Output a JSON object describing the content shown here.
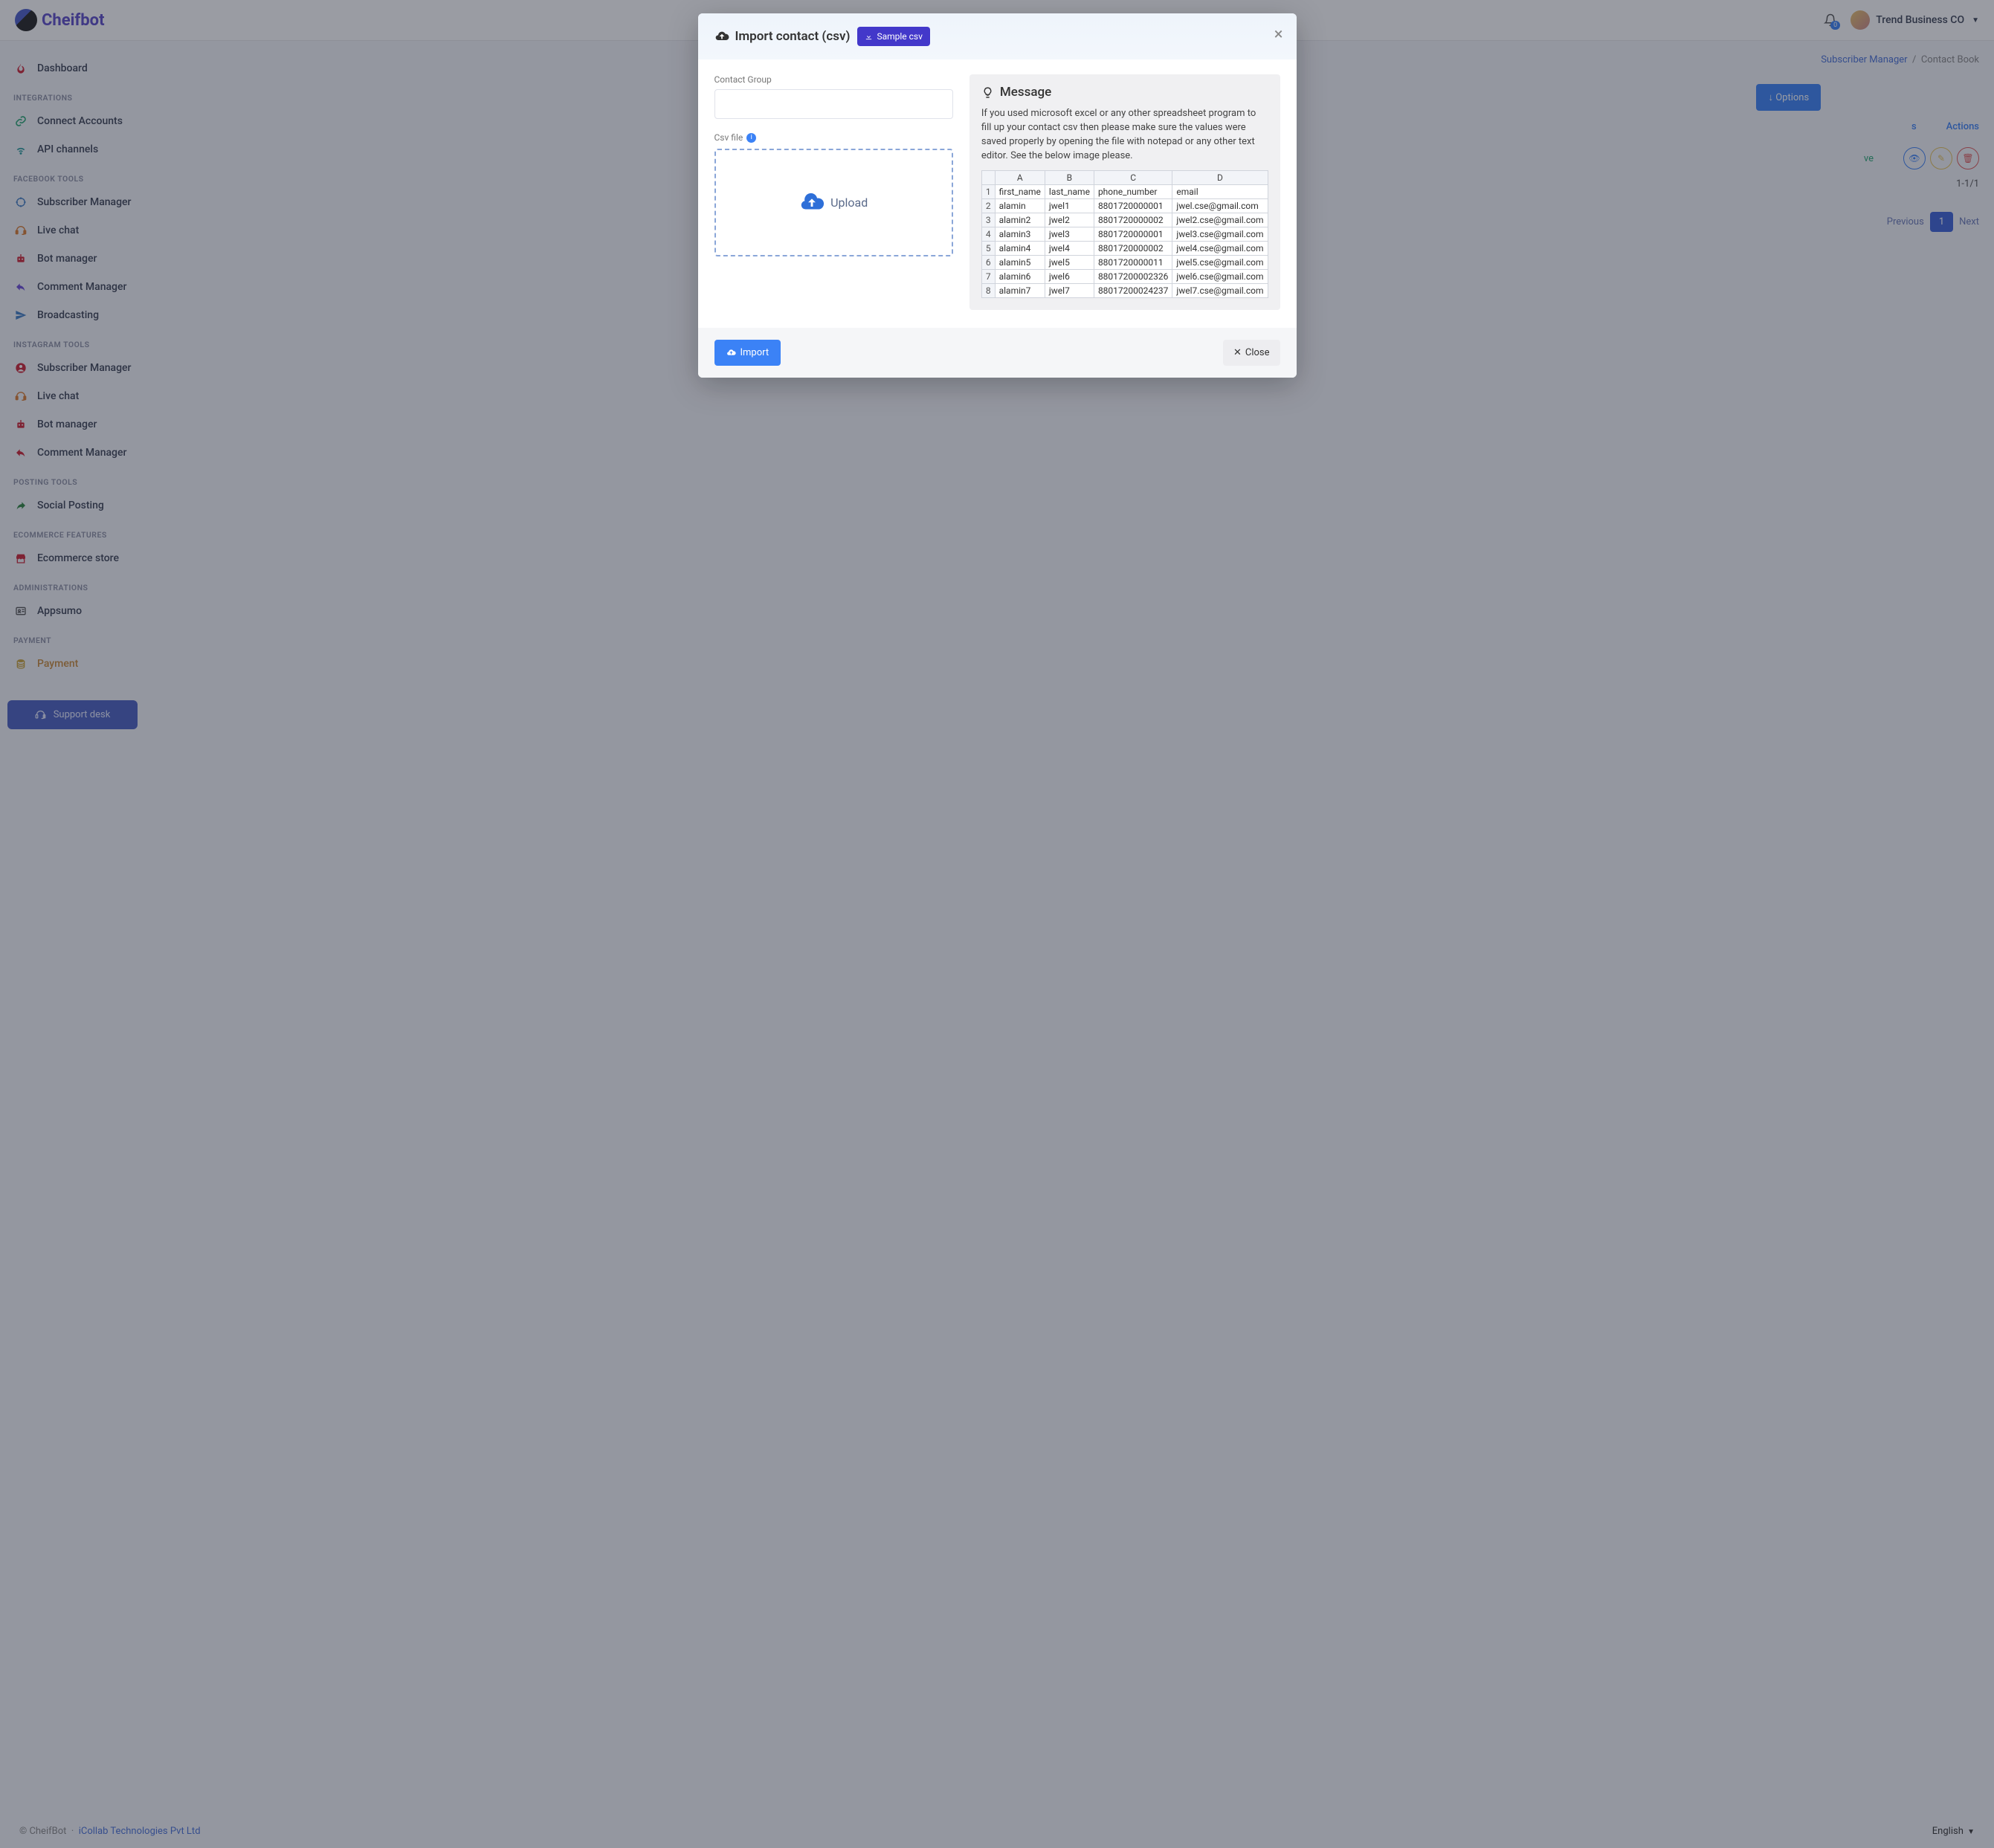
{
  "brand": "Cheifbot",
  "topbar": {
    "user_label": "Trend Business CO",
    "bell_count": "0"
  },
  "sidebar": {
    "dashboard": "Dashboard",
    "groups": [
      {
        "title": "INTEGRATIONS",
        "items": [
          {
            "label": "Connect Accounts",
            "color": "green",
            "icon": "connect-icon"
          },
          {
            "label": "API channels",
            "color": "teal",
            "icon": "wifi-icon"
          }
        ]
      },
      {
        "title": "FACEBOOK TOOLS",
        "items": [
          {
            "label": "Subscriber Manager",
            "color": "blue",
            "icon": "crosshair-icon"
          },
          {
            "label": "Live chat",
            "color": "orange",
            "icon": "headset-icon"
          },
          {
            "label": "Bot manager",
            "color": "red",
            "icon": "robot-icon"
          },
          {
            "label": "Comment Manager",
            "color": "purple",
            "icon": "reply-icon"
          },
          {
            "label": "Broadcasting",
            "color": "blue",
            "icon": "plane-icon"
          }
        ]
      },
      {
        "title": "INSTAGRAM TOOLS",
        "items": [
          {
            "label": "Subscriber Manager",
            "color": "red",
            "icon": "user-circle-icon"
          },
          {
            "label": "Live chat",
            "color": "orange",
            "icon": "headset-icon"
          },
          {
            "label": "Bot manager",
            "color": "red",
            "icon": "robot-icon"
          },
          {
            "label": "Comment Manager",
            "color": "red",
            "icon": "reply-icon"
          }
        ]
      },
      {
        "title": "POSTING TOOLS",
        "items": [
          {
            "label": "Social Posting",
            "color": "dkgreen",
            "icon": "share-icon"
          }
        ]
      },
      {
        "title": "ECOMMERCE FEATURES",
        "items": [
          {
            "label": "Ecommerce store",
            "color": "red",
            "icon": "store-icon"
          }
        ]
      },
      {
        "title": "ADMINISTRATIONS",
        "items": [
          {
            "label": "Appsumo",
            "color": "dgray",
            "icon": "id-icon"
          }
        ]
      },
      {
        "title": "PAYMENT",
        "items": [
          {
            "label": "Payment",
            "color": "gold",
            "icon": "coins-icon",
            "accent": true
          }
        ]
      }
    ],
    "support": "Support desk"
  },
  "breadcrumb": {
    "parent": "Subscriber Manager",
    "current": "Contact Book"
  },
  "page": {
    "options_btn": "Options",
    "columns": {
      "s": "s",
      "actions": "Actions"
    },
    "row": {
      "val": "ve"
    },
    "count": "1-1/1",
    "pager": {
      "prev": "Previous",
      "page": "1",
      "next": "Next"
    }
  },
  "footer": {
    "copyright": "© CheifBot",
    "sep": "·",
    "company": "iCollab Technologies Pvt Ltd",
    "lang": "English"
  },
  "modal": {
    "title": "Import contact (csv)",
    "sample_btn": "Sample csv",
    "contact_group_label": "Contact Group",
    "csv_file_label": "Csv file",
    "upload_label": "Upload",
    "message_title": "Message",
    "message_body": "If you used microsoft excel or any other spreadsheet program to fill up your contact csv then please make sure the values were saved properly by opening the file with notepad or any other text editor. See the below image please.",
    "cols": [
      "A",
      "B",
      "C",
      "D"
    ],
    "headers": [
      "first_name",
      "last_name",
      "phone_number",
      "email"
    ],
    "rows": [
      [
        "alamin",
        "jwel1",
        "8801720000001",
        "jwel.cse@gmail.com"
      ],
      [
        "alamin2",
        "jwel2",
        "8801720000002",
        "jwel2.cse@gmail.com"
      ],
      [
        "alamin3",
        "jwel3",
        "8801720000001",
        "jwel3.cse@gmail.com"
      ],
      [
        "alamin4",
        "jwel4",
        "8801720000002",
        "jwel4.cse@gmail.com"
      ],
      [
        "alamin5",
        "jwel5",
        "8801720000011",
        "jwel5.cse@gmail.com"
      ],
      [
        "alamin6",
        "jwel6",
        "88017200002326",
        "jwel6.cse@gmail.com"
      ],
      [
        "alamin7",
        "jwel7",
        "88017200024237",
        "jwel7.cse@gmail.com"
      ]
    ],
    "import_btn": "Import",
    "close_btn": "Close"
  }
}
